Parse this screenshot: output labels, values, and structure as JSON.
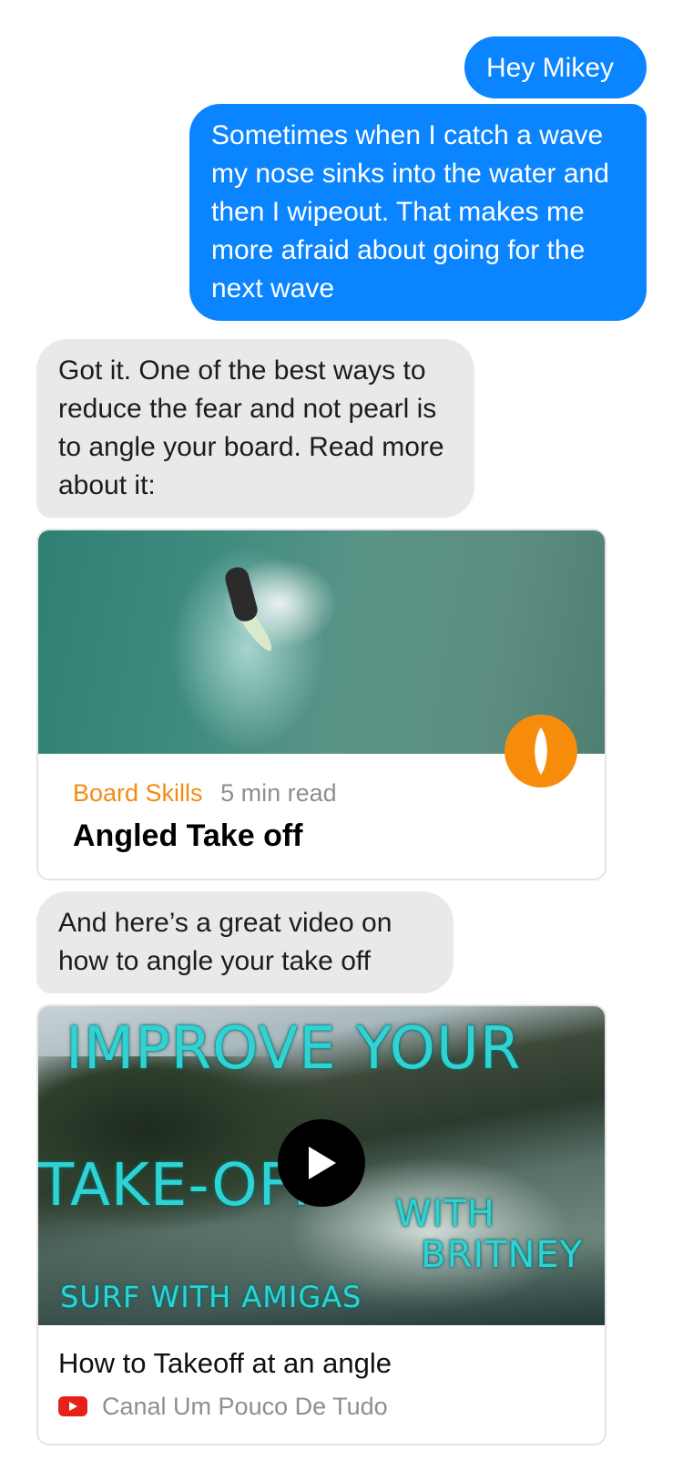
{
  "messages": {
    "m1": "Hey Mikey",
    "m2": "Sometimes when I catch a wave my nose sinks into the water and then I wipeout. That makes me more afraid about going for the next wave",
    "m3": "Got it. One of the best ways to reduce the fear and not pearl is to angle your board. Read more about it:",
    "m4": "And here’s a great video on how to angle your take off"
  },
  "article": {
    "category": "Board Skills",
    "read_time": "5 min read",
    "title": "Angled Take off",
    "badge_icon": "surfboard-icon",
    "badge_color": "#f78c0b"
  },
  "video": {
    "thumbnail_text": {
      "line1": "IMPROVE YOUR",
      "line2": "TAKE-OFF",
      "line3": "WITH",
      "line4": "BRITNEY",
      "line5": "SURF WITH AMIGAS"
    },
    "title": "How to Takeoff at an angle",
    "channel": "Canal Um Pouco De Tudo",
    "play_icon": "play-icon",
    "source_icon": "youtube-icon"
  },
  "colors": {
    "outgoing_bubble": "#0a84ff",
    "incoming_bubble": "#e9e9eb",
    "accent_orange": "#f38b12"
  }
}
